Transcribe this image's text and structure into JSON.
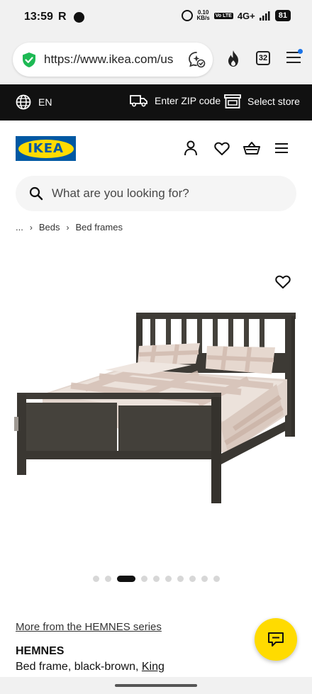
{
  "status_bar": {
    "time": "13:59",
    "r_label": "R",
    "speed_value": "0.10",
    "speed_unit": "KB/s",
    "volte": "Vo LTE",
    "network": "4G+",
    "battery": "81"
  },
  "browser": {
    "url": "https://www.ikea.com/us",
    "tab_count": "32",
    "secure_color": "#1db954"
  },
  "top_strip": {
    "language": "EN",
    "zip_label": "Enter ZIP code",
    "store_label": "Select store"
  },
  "header": {
    "logo_text": "IKEA",
    "brand_blue": "#0058a3",
    "brand_yellow": "#ffdb00"
  },
  "search": {
    "placeholder": "What are you looking for?"
  },
  "breadcrumb": {
    "ellipsis": "...",
    "items": [
      "Beds",
      "Bed frames"
    ]
  },
  "gallery": {
    "image_count": 10,
    "active_index": 2
  },
  "product": {
    "series_link": "More from the HEMNES series",
    "name": "HEMNES",
    "description_prefix": "Bed frame, black-brown, ",
    "size": "King"
  }
}
